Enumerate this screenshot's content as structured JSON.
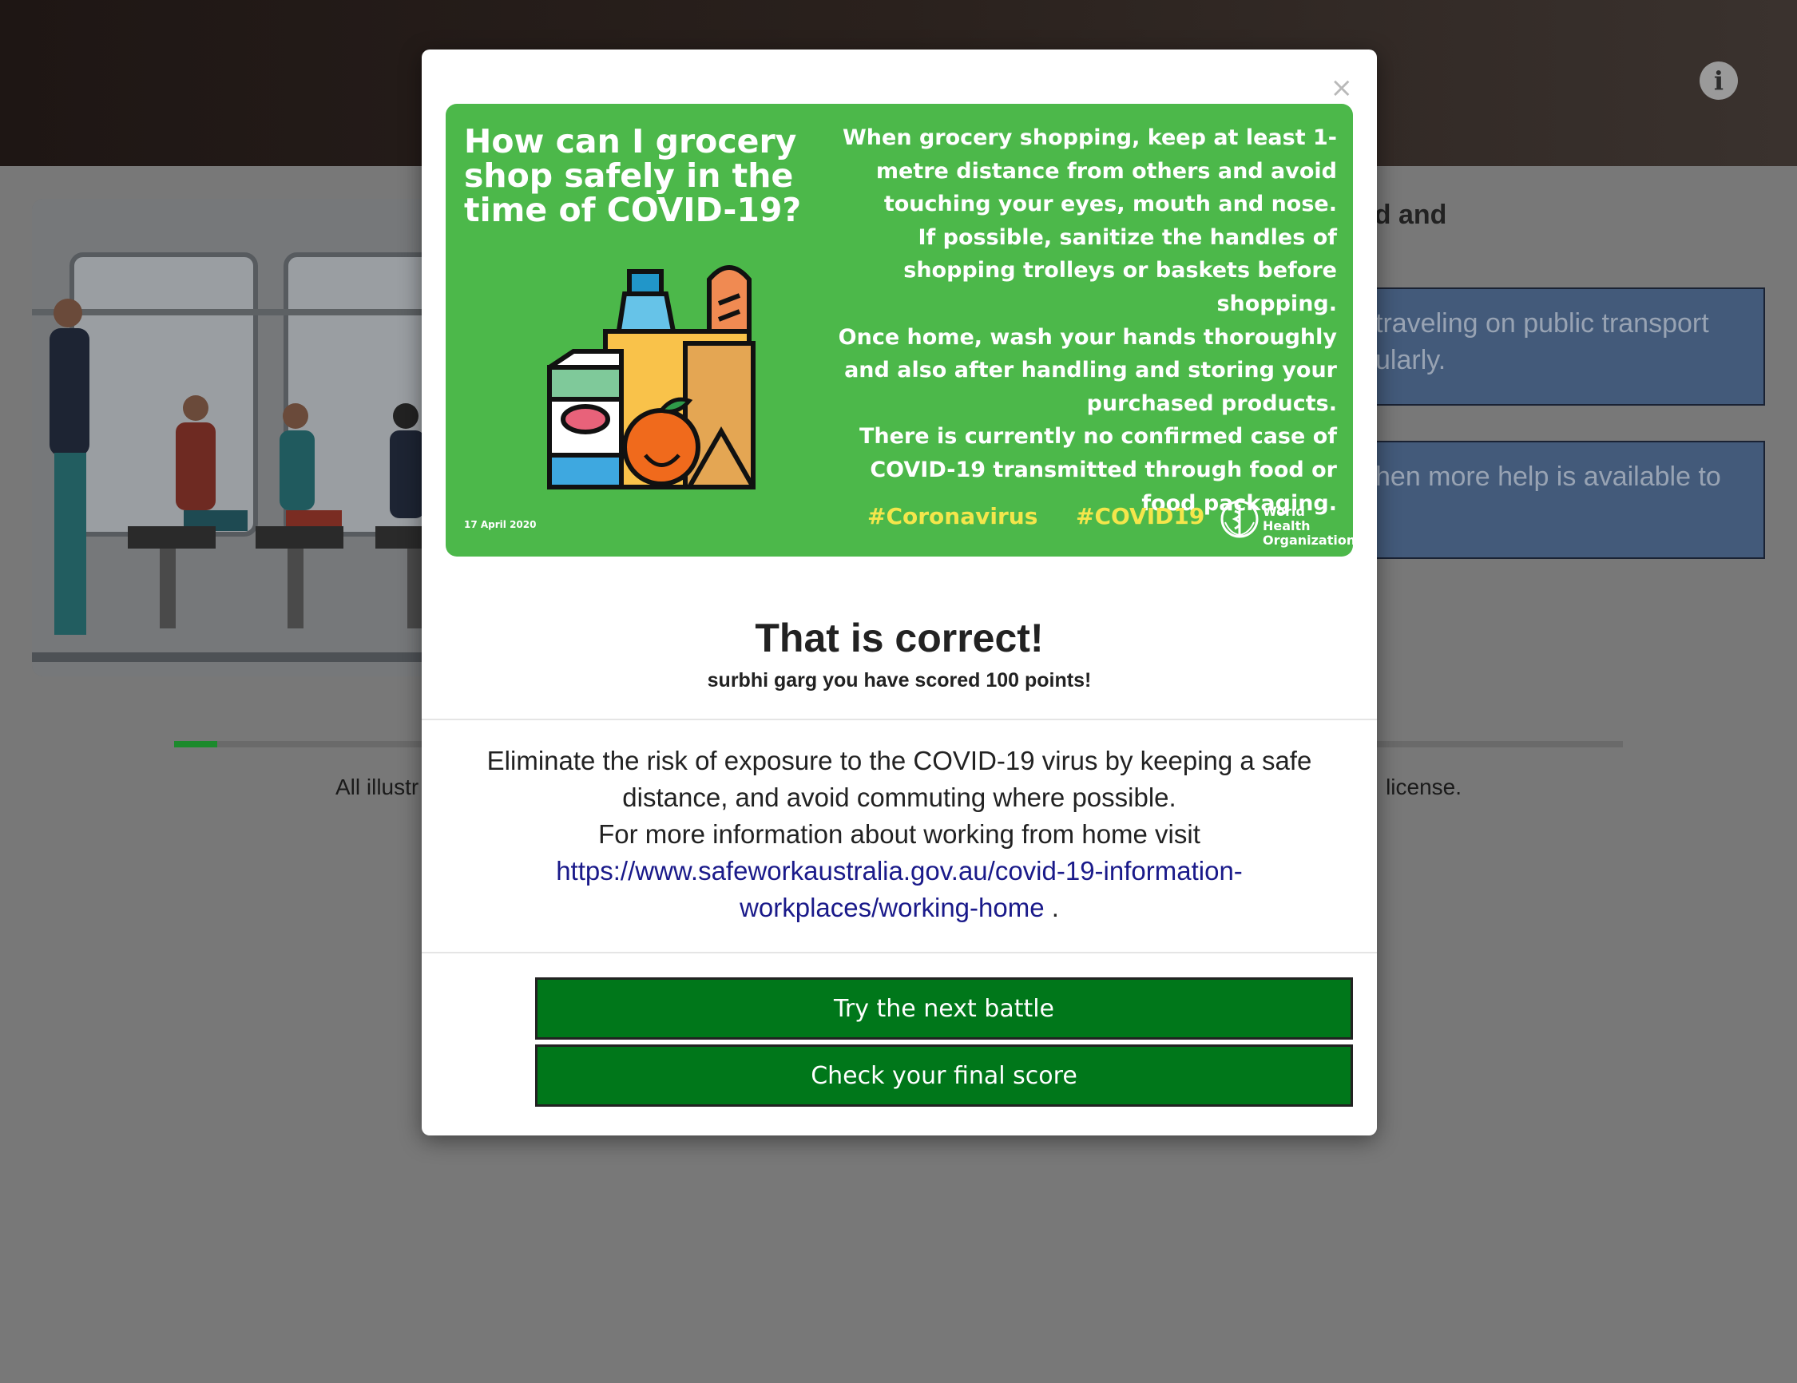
{
  "page": {
    "question_fragment": "od and",
    "answers": [
      {
        "line1": "traveling on public transport",
        "line2": "ularly."
      },
      {
        "line1": "hen more help is available to",
        "line2": ""
      }
    ],
    "credit_left": "All illustr",
    "credit_right": "license.",
    "progress_fraction": 0.03
  },
  "poster": {
    "title": "How can I grocery shop safely in the time of COVID-19?",
    "body": [
      "When grocery shopping, keep at least 1-metre distance from others and avoid touching your eyes, mouth and nose.",
      "If possible, sanitize the handles of shopping trolleys or baskets before shopping.",
      "Once home, wash your hands thoroughly and also after handling and storing your purchased products.",
      "There is currently no confirmed case of COVID-19 transmitted through food or food packaging."
    ],
    "date": "17 April 2020",
    "hashtag1": "#Coronavirus",
    "hashtag2": "#COVID19",
    "org_line1": "World Health",
    "org_line2": "Organization"
  },
  "modal": {
    "close_label": "×",
    "result_title": "That is correct!",
    "score_message": "surbhi garg you have scored 100 points!",
    "explanation_line1": "Eliminate the risk of exposure to the COVID-19 virus by keeping a safe distance, and avoid commuting where possible.",
    "explanation_line2_prefix": "For more information about working from home visit",
    "explanation_link": "https://www.safeworkaustralia.gov.au/covid-19-information-workplaces/working-home",
    "explanation_suffix": ".",
    "next_button": "Try the next battle",
    "final_button": "Check your final score"
  },
  "icons": {
    "info": "info-icon",
    "close": "close-icon",
    "who_logo": "who-emblem-icon",
    "grocery": "grocery-bag-icon"
  }
}
